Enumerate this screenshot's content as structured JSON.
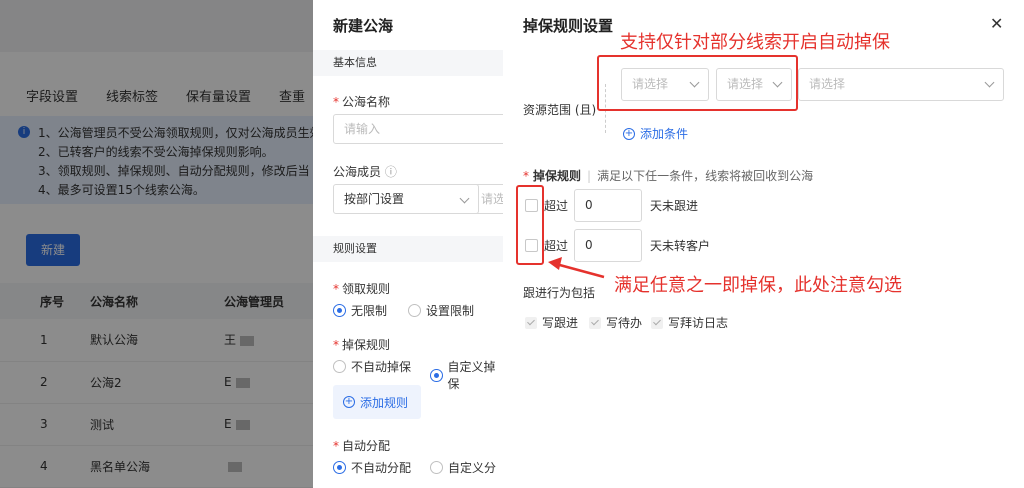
{
  "background": {
    "tabs": [
      "字段设置",
      "线索标签",
      "保有量设置",
      "查重"
    ],
    "notice_lines": [
      "1、公海管理员不受公海领取规则，仅对公海成员生效",
      "2、已转客户的线索不受公海掉保规则影响。",
      "3、领取规则、掉保规则、自动分配规则，修改后当",
      "4、最多可设置15个线索公海。"
    ],
    "new_button": "新建",
    "table": {
      "headers": [
        "序号",
        "公海名称",
        "公海管理员"
      ],
      "rows": [
        [
          "1",
          "默认公海",
          "王"
        ],
        [
          "2",
          "公海2",
          "E"
        ],
        [
          "3",
          "测试",
          "E"
        ],
        [
          "4",
          "黑名单公海",
          ""
        ]
      ]
    }
  },
  "new_pool_drawer": {
    "title": "新建公海",
    "section_basic": "基本信息",
    "name_label": "公海名称",
    "name_placeholder": "请输入",
    "members_label": "公海成员",
    "members_select": "按部门设置",
    "members_select2": "请选",
    "section_rules": "规则设置",
    "claim_label": "领取规则",
    "claim_options": [
      "无限制",
      "设置限制"
    ],
    "drop_label": "掉保规则",
    "drop_options": [
      "不自动掉保",
      "自定义掉保"
    ],
    "add_rule": "添加规则",
    "assign_label": "自动分配",
    "assign_options": [
      "不自动分配",
      "自定义分"
    ]
  },
  "drop_rule_drawer": {
    "title": "掉保规则设置",
    "resource_label": "资源范围 (且)",
    "selects": [
      "请选择",
      "请选择",
      "请选择"
    ],
    "add_condition": "添加条件",
    "rule_title": "掉保规则",
    "rule_desc": "满足以下任一条件，线索将被回收到公海",
    "conditions": [
      {
        "prefix": "超过",
        "value": "0",
        "suffix": "天未跟进"
      },
      {
        "prefix": "超过",
        "value": "0",
        "suffix": "天未转客户"
      }
    ],
    "follow_label": "跟进行为包括",
    "follow_items": [
      "写跟进",
      "写待办",
      "写拜访日志"
    ]
  },
  "annotations": {
    "top": "支持仅针对部分线索开启自动掉保",
    "bottom": "满足任意之一即掉保，此处注意勾选"
  },
  "colors": {
    "accent": "#2b6de5",
    "annotation_red": "#e5322d"
  }
}
